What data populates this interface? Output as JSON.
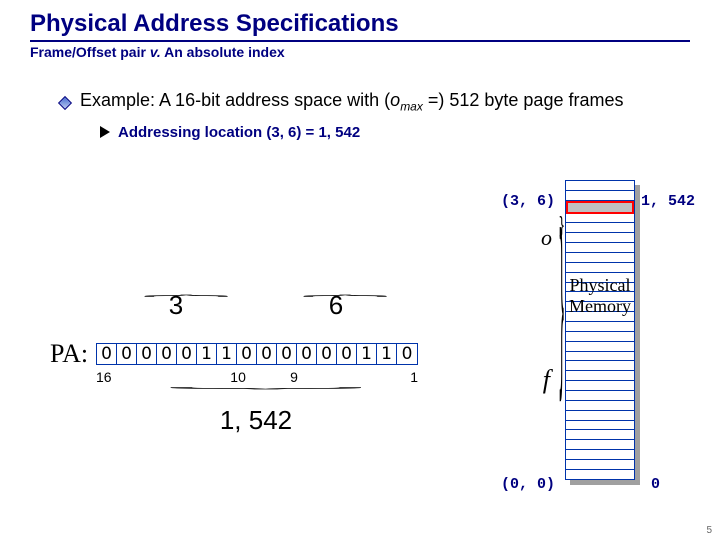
{
  "header": {
    "title": "Physical Address Specifications",
    "subtitle_pre": "Frame/Offset pair ",
    "subtitle_ital": "v.",
    "subtitle_post": " An absolute index"
  },
  "bullet": {
    "text_pre": "Example: A 16-bit address space with (",
    "var": "o",
    "subscript": "max",
    "text_post": " =) 512 byte page frames"
  },
  "arrow": {
    "text": "Addressing location (3, 6) = 1, 542"
  },
  "pa": {
    "top_left": "3",
    "top_right": "6",
    "label": "PA:",
    "bits": [
      "0",
      "0",
      "0",
      "0",
      "0",
      "1",
      "1",
      "0",
      "0",
      "0",
      "0",
      "0",
      "0",
      "1",
      "1",
      "0"
    ],
    "num_left": "16",
    "num_mid_l": "10",
    "num_mid_r": "9",
    "num_right": "1",
    "bottom": "1, 542"
  },
  "mem": {
    "top_coord": "(3, 6)",
    "top_val": "1, 542",
    "o": "o",
    "f": "f",
    "phys": "Physical Memory",
    "bot_coord": "(0, 0)",
    "bot_val": "0",
    "rows": 30,
    "target": 2
  },
  "slidenum": "5"
}
